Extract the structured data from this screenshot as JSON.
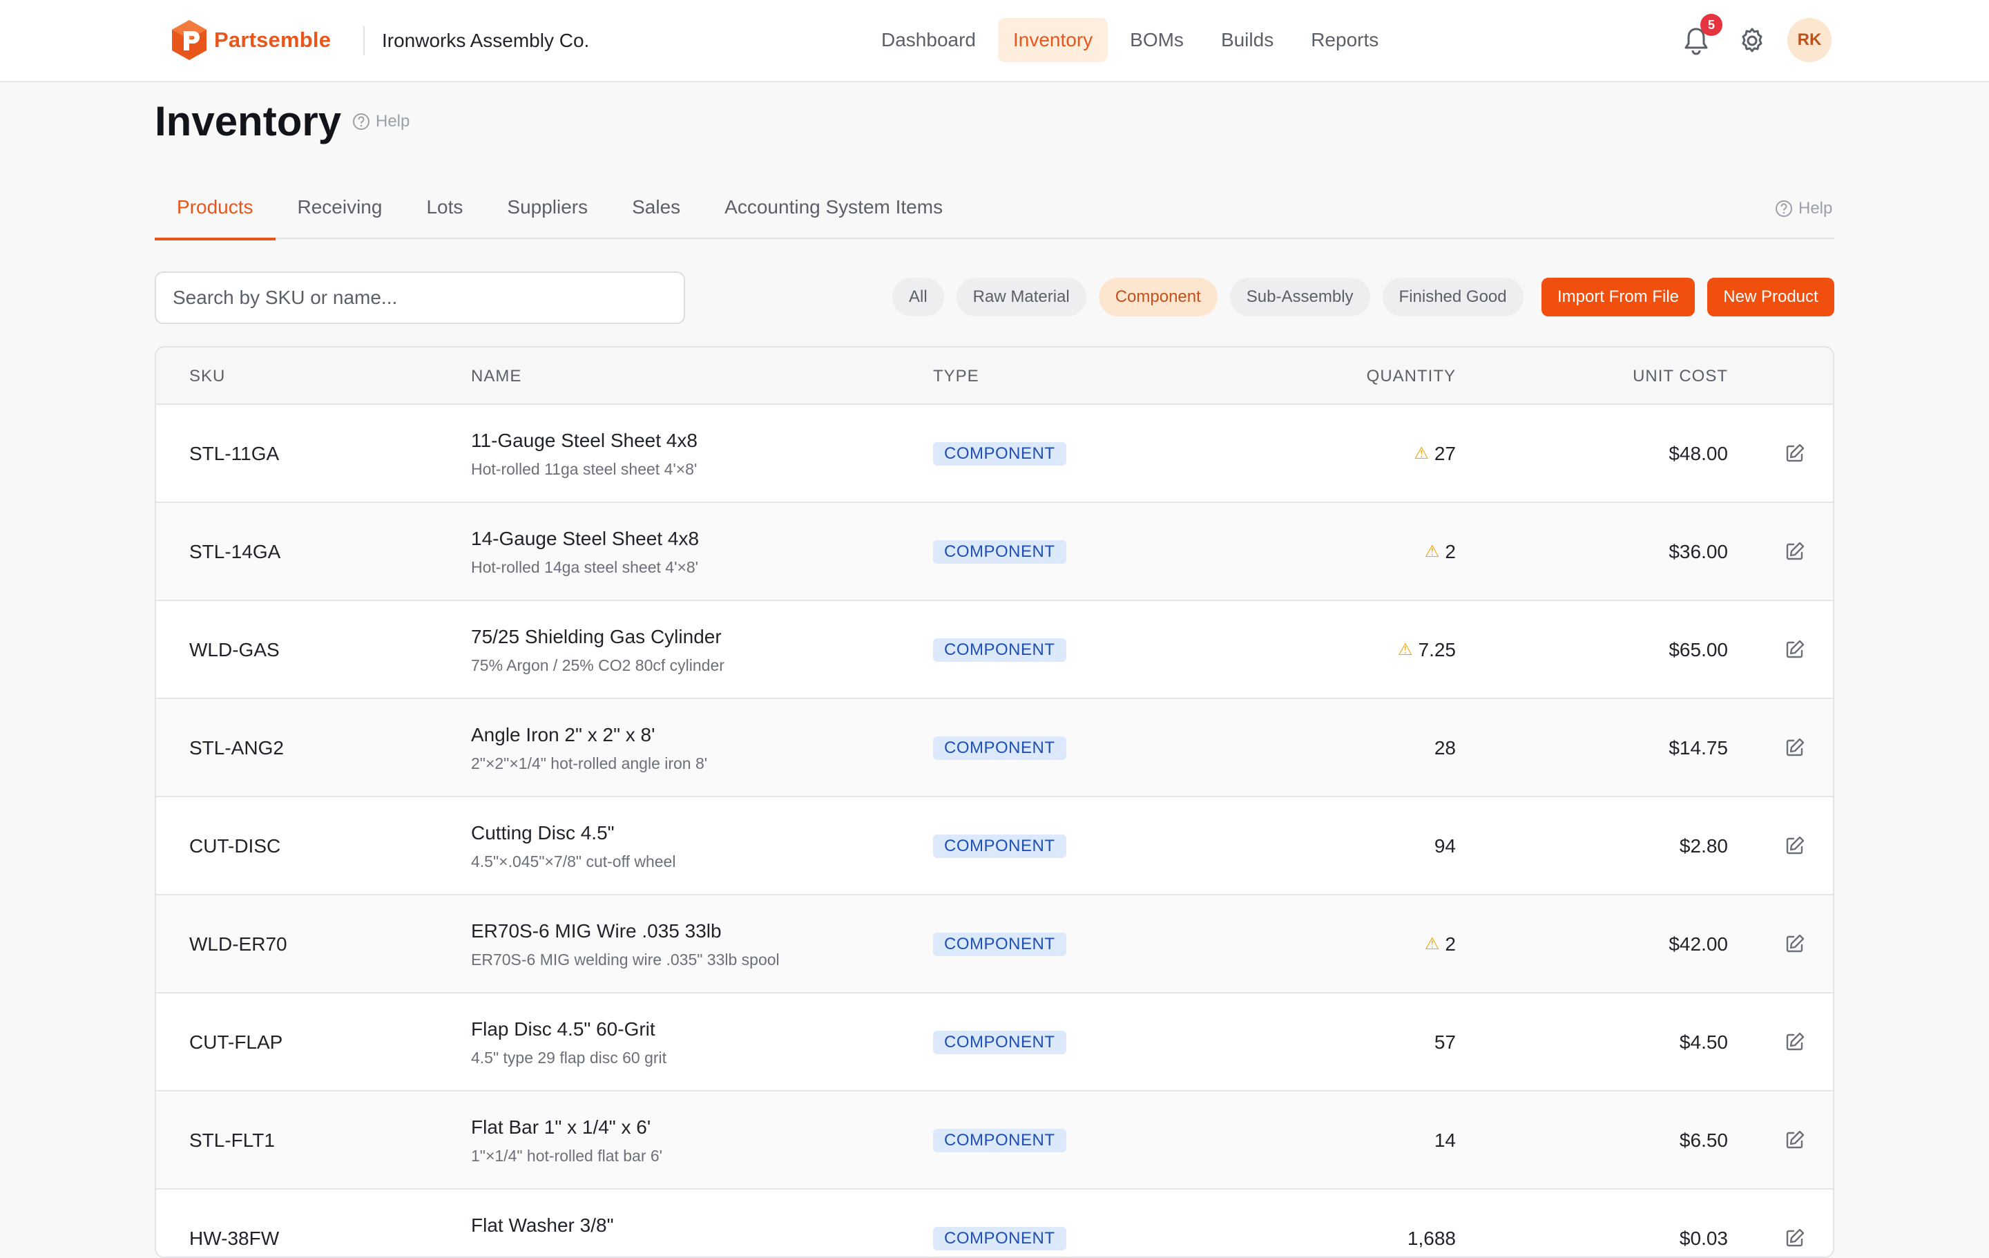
{
  "brand": {
    "name": "Partsemble",
    "company": "Ironworks Assembly Co.",
    "accent": "#e8561c"
  },
  "nav": {
    "items": [
      "Dashboard",
      "Inventory",
      "BOMs",
      "Builds",
      "Reports"
    ],
    "active": "Inventory",
    "notifications": "5",
    "avatar_initials": "RK"
  },
  "page": {
    "title": "Inventory",
    "help": "Help"
  },
  "tabs": {
    "items": [
      "Products",
      "Receiving",
      "Lots",
      "Suppliers",
      "Sales",
      "Accounting System Items"
    ],
    "active": "Products",
    "help": "Help"
  },
  "toolbar": {
    "search_placeholder": "Search by SKU or name...",
    "filters": [
      "All",
      "Raw Material",
      "Component",
      "Sub-Assembly",
      "Finished Good"
    ],
    "active_filter": "Component",
    "import_label": "Import From File",
    "new_label": "New Product"
  },
  "table": {
    "headers": {
      "sku": "SKU",
      "name": "NAME",
      "type": "TYPE",
      "quantity": "QUANTITY",
      "unit_cost": "UNIT COST"
    },
    "rows": [
      {
        "sku": "STL-11GA",
        "name": "11-Gauge Steel Sheet 4x8",
        "desc": "Hot-rolled 11ga steel sheet 4'×8'",
        "type": "COMPONENT",
        "qty": "27",
        "low": true,
        "cost": "$48.00"
      },
      {
        "sku": "STL-14GA",
        "name": "14-Gauge Steel Sheet 4x8",
        "desc": "Hot-rolled 14ga steel sheet 4'×8'",
        "type": "COMPONENT",
        "qty": "2",
        "low": true,
        "cost": "$36.00"
      },
      {
        "sku": "WLD-GAS",
        "name": "75/25 Shielding Gas Cylinder",
        "desc": "75% Argon / 25% CO2 80cf cylinder",
        "type": "COMPONENT",
        "qty": "7.25",
        "low": true,
        "cost": "$65.00"
      },
      {
        "sku": "STL-ANG2",
        "name": "Angle Iron 2\" x 2\" x 8'",
        "desc": "2\"×2\"×1/4\" hot-rolled angle iron 8'",
        "type": "COMPONENT",
        "qty": "28",
        "low": false,
        "cost": "$14.75"
      },
      {
        "sku": "CUT-DISC",
        "name": "Cutting Disc 4.5\"",
        "desc": "4.5\"×.045\"×7/8\" cut-off wheel",
        "type": "COMPONENT",
        "qty": "94",
        "low": false,
        "cost": "$2.80"
      },
      {
        "sku": "WLD-ER70",
        "name": "ER70S-6 MIG Wire .035 33lb",
        "desc": "ER70S-6 MIG welding wire .035\" 33lb spool",
        "type": "COMPONENT",
        "qty": "2",
        "low": true,
        "cost": "$42.00"
      },
      {
        "sku": "CUT-FLAP",
        "name": "Flap Disc 4.5\" 60-Grit",
        "desc": "4.5\" type 29 flap disc 60 grit",
        "type": "COMPONENT",
        "qty": "57",
        "low": false,
        "cost": "$4.50"
      },
      {
        "sku": "STL-FLT1",
        "name": "Flat Bar 1\" x 1/4\" x 6'",
        "desc": "1\"×1/4\" hot-rolled flat bar 6'",
        "type": "COMPONENT",
        "qty": "14",
        "low": false,
        "cost": "$6.50"
      },
      {
        "sku": "HW-38FW",
        "name": "Flat Washer 3/8\"",
        "desc": "",
        "type": "COMPONENT",
        "qty": "1,688",
        "low": false,
        "cost": "$0.03"
      }
    ]
  }
}
